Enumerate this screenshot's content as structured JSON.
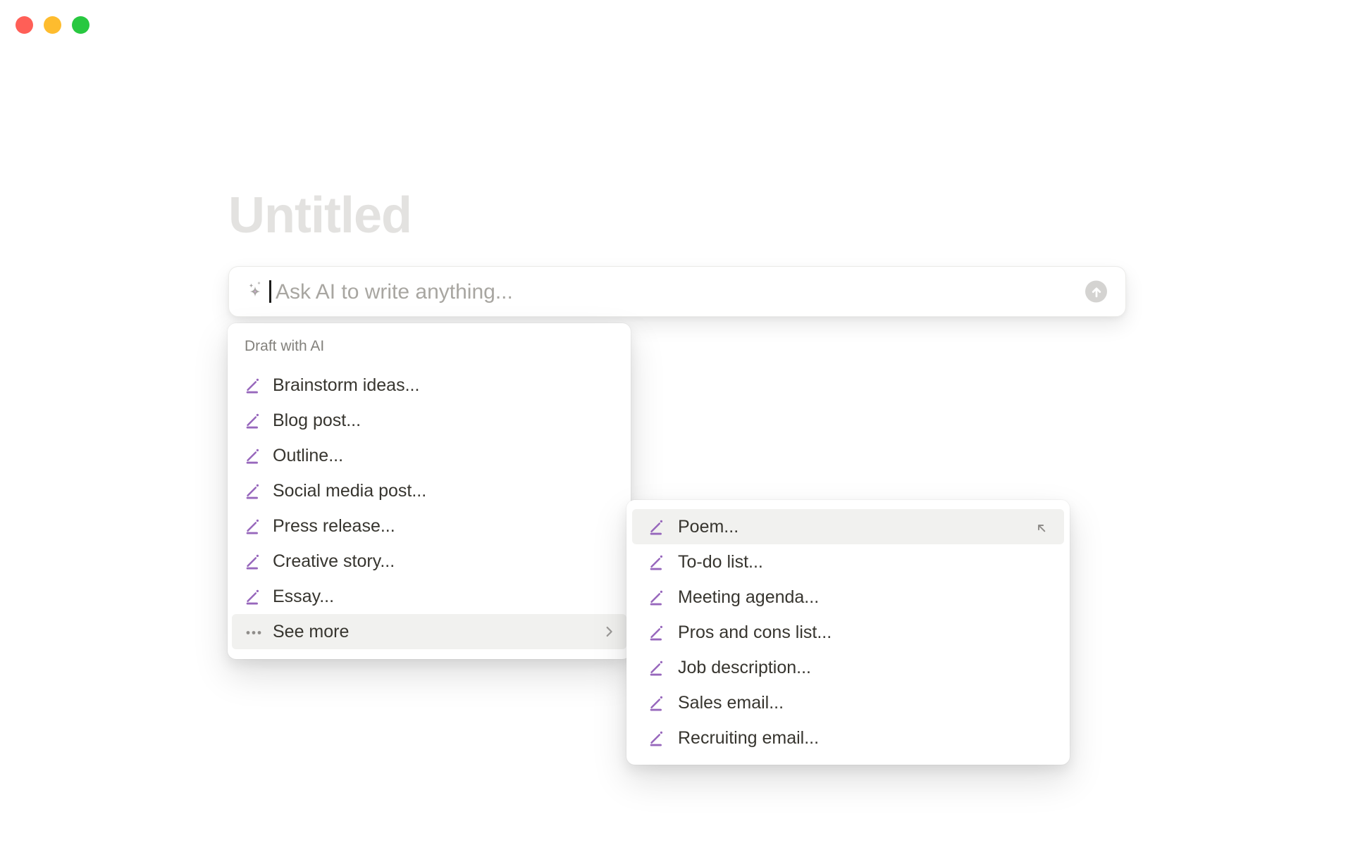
{
  "window": {
    "controls": [
      {
        "name": "close",
        "color": "#FF5F57"
      },
      {
        "name": "minimize",
        "color": "#FEBC2E"
      },
      {
        "name": "zoom",
        "color": "#28C840"
      }
    ]
  },
  "page": {
    "title_placeholder": "Untitled"
  },
  "ai_input": {
    "placeholder": "Ask AI to write anything...",
    "leading_icon": "ai-sparkle-icon",
    "submit_icon": "arrow-up-icon",
    "cursor_visible": true
  },
  "draft_menu": {
    "header": "Draft with AI",
    "items": [
      {
        "label": "Brainstorm ideas...",
        "icon": "pencil-line-icon"
      },
      {
        "label": "Blog post...",
        "icon": "pencil-line-icon"
      },
      {
        "label": "Outline...",
        "icon": "pencil-line-icon"
      },
      {
        "label": "Social media post...",
        "icon": "pencil-line-icon"
      },
      {
        "label": "Press release...",
        "icon": "pencil-line-icon"
      },
      {
        "label": "Creative story...",
        "icon": "pencil-line-icon"
      },
      {
        "label": "Essay...",
        "icon": "pencil-line-icon"
      }
    ],
    "see_more": {
      "label": "See more",
      "icon": "ellipsis-icon",
      "trailing_icon": "chevron-right-icon",
      "highlighted": true
    }
  },
  "submenu": {
    "items": [
      {
        "label": "Poem...",
        "icon": "pencil-line-icon",
        "highlighted": true,
        "trailing_icon": "arrow-up-left-icon"
      },
      {
        "label": "To-do list...",
        "icon": "pencil-line-icon"
      },
      {
        "label": "Meeting agenda...",
        "icon": "pencil-line-icon"
      },
      {
        "label": "Pros and cons list...",
        "icon": "pencil-line-icon"
      },
      {
        "label": "Job description...",
        "icon": "pencil-line-icon"
      },
      {
        "label": "Sales email...",
        "icon": "pencil-line-icon"
      },
      {
        "label": "Recruiting email...",
        "icon": "pencil-line-icon"
      }
    ]
  },
  "colors": {
    "accent_purple": "#9767BC",
    "menu_text": "#37352F",
    "section_label_text": "#83817C",
    "placeholder_text": "#A8A6A1",
    "title_placeholder_text": "#E3E2E0",
    "row_highlight": "#F1F1EF",
    "send_button_bg": "#D4D3D1",
    "icon_gray": "#8F8D8A"
  }
}
